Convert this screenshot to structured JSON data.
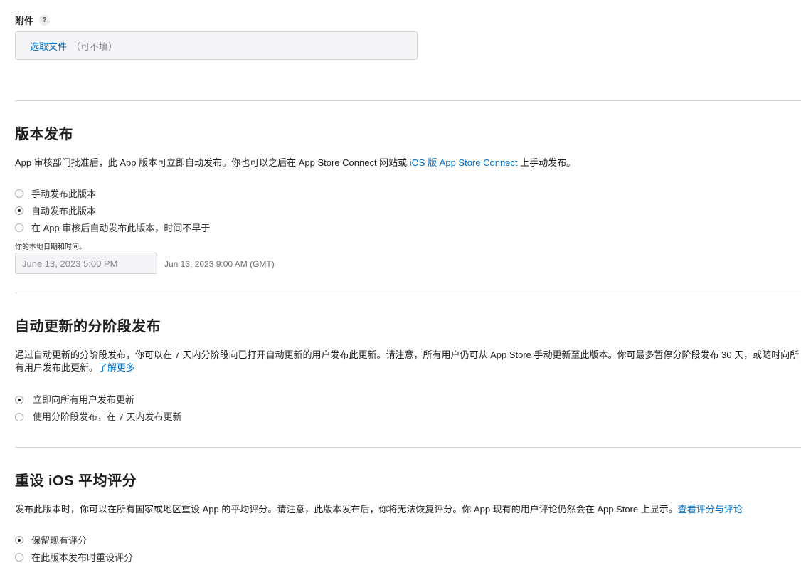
{
  "attachment": {
    "label": "附件",
    "help": "?",
    "choose_file": "选取文件",
    "optional": "（可不填）"
  },
  "version_release": {
    "title": "版本发布",
    "desc_before": "App 审核部门批准后，此 App 版本可立即自动发布。你也可以之后在 App Store Connect 网站或 ",
    "desc_link": "iOS 版 App Store Connect",
    "desc_after": " 上手动发布。",
    "options": [
      {
        "label": "手动发布此版本",
        "checked": false
      },
      {
        "label": "自动发布此版本",
        "checked": true
      },
      {
        "label": "在 App 审核后自动发布此版本，时间不早于",
        "checked": false
      }
    ],
    "local_time_note": "你的本地日期和时间。",
    "date_placeholder": "June 13, 2023 5:00 PM",
    "gmt_time": "Jun 13, 2023 9:00 AM (GMT)"
  },
  "phased_release": {
    "title": "自动更新的分阶段发布",
    "desc_line1": "通过自动更新的分阶段发布，你可以在 7 天内分阶段向已打开自动更新的用户发布此更新。请注意，所有用户仍可从 App Store 手动更新至此版本。你可最多暂停分阶段发布 30 天，或随时向所",
    "desc_line2": "有用户发布此更新。",
    "desc_link": "了解更多",
    "options": [
      {
        "label": "立即向所有用户发布更新",
        "checked": true
      },
      {
        "label": "使用分阶段发布，在 7 天内发布更新",
        "checked": false
      }
    ]
  },
  "reset_ratings": {
    "title": "重设 iOS 平均评分",
    "desc": "发布此版本时，你可以在所有国家或地区重设 App 的平均评分。请注意，此版本发布后，你将无法恢复评分。你 App 现有的用户评论仍然会在 App Store 上显示。",
    "desc_link": "查看评分与评论",
    "options": [
      {
        "label": "保留现有评分",
        "checked": true
      },
      {
        "label": "在此版本发布时重设评分",
        "checked": false
      }
    ]
  }
}
